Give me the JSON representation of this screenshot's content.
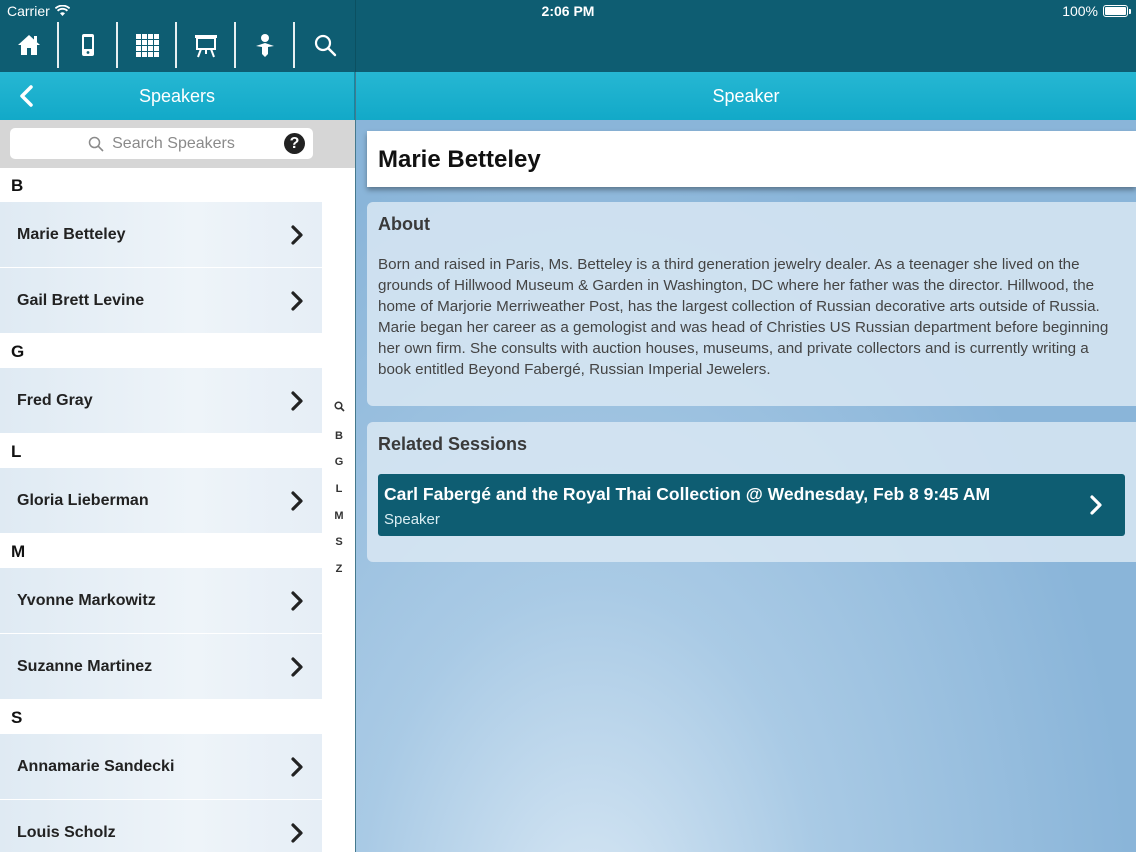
{
  "status": {
    "carrier": "Carrier",
    "time": "2:06 PM",
    "battery": "100%"
  },
  "toolbar": {
    "icons": [
      "home-icon",
      "phone-icon",
      "grid-icon",
      "easel-icon",
      "person-icon",
      "search-icon"
    ]
  },
  "left_header": {
    "title": "Speakers"
  },
  "right_header": {
    "title": "Speaker"
  },
  "search": {
    "placeholder": "Search Speakers",
    "help": "?"
  },
  "sections": [
    {
      "letter": "B",
      "speakers": [
        "Marie Betteley",
        "Gail Brett Levine"
      ]
    },
    {
      "letter": "G",
      "speakers": [
        "Fred Gray"
      ]
    },
    {
      "letter": "L",
      "speakers": [
        "Gloria Lieberman"
      ]
    },
    {
      "letter": "M",
      "speakers": [
        "Yvonne Markowitz",
        "Suzanne Martinez"
      ]
    },
    {
      "letter": "S",
      "speakers": [
        "Annamarie Sandecki",
        "Louis Scholz"
      ]
    }
  ],
  "index": [
    "Q",
    "B",
    "G",
    "L",
    "M",
    "S",
    "Z"
  ],
  "speaker": {
    "name": "Marie Betteley",
    "about_heading": "About",
    "about_text": "Born and raised in Paris, Ms. Betteley is a third generation jewelry dealer. As a teenager she lived on the grounds of Hillwood Museum & Garden in Washington, DC where her father was the director. Hillwood, the home of Marjorie Merriweather Post, has the largest collection of Russian decorative arts outside of Russia. Marie began her career as a gemologist and was head of Christies US Russian department before beginning her own firm. She consults with auction houses, museums, and private collectors and is currently writing a book entitled Beyond Fabergé, Russian Imperial Jewelers.",
    "related_heading": "Related Sessions",
    "sessions": [
      {
        "title": "Carl Fabergé and the Royal Thai Collection @ Wednesday, Feb 8 9:45 AM",
        "role": "Speaker"
      }
    ]
  },
  "colors": {
    "dark_teal": "#0e5d72",
    "header_cyan": "#19afcc"
  }
}
